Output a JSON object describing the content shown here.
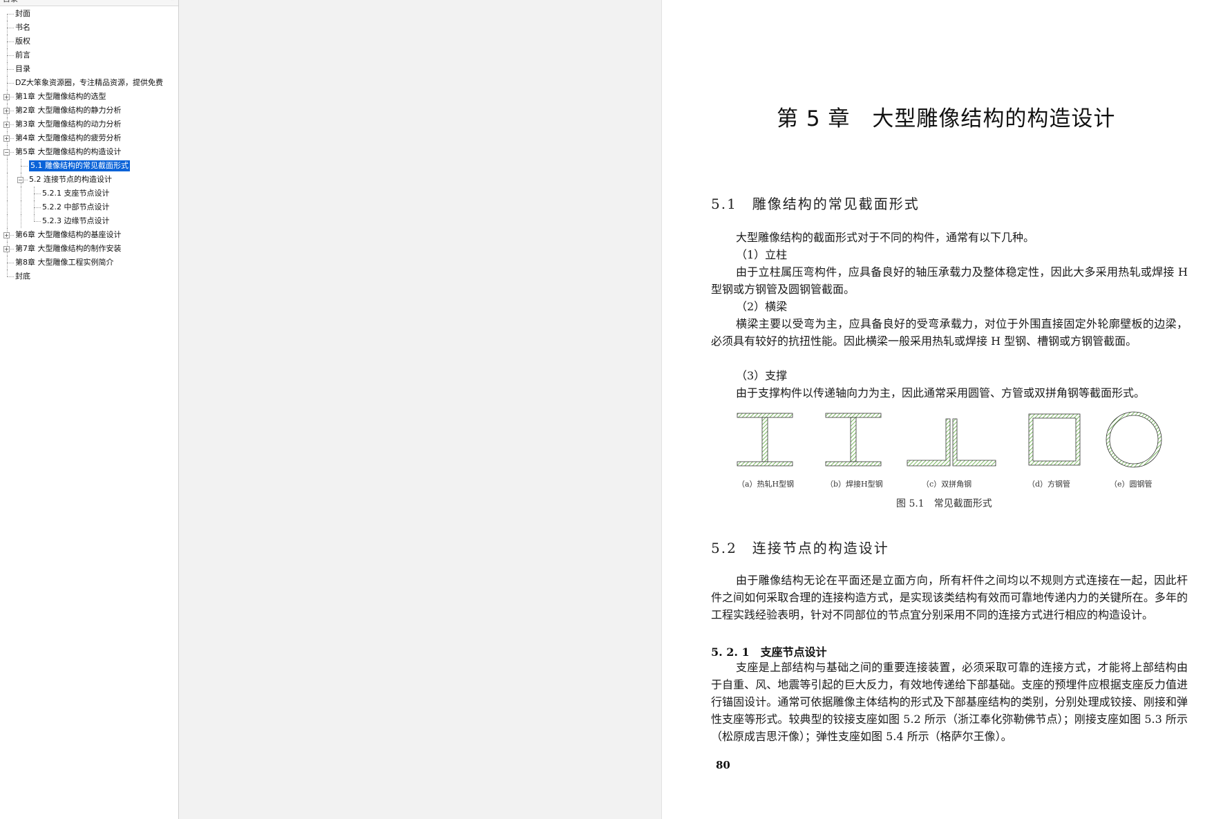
{
  "sidebar": {
    "header_title": "目录",
    "close_glyph": "«",
    "items": [
      {
        "label": "封面",
        "level": 0,
        "toggle": ""
      },
      {
        "label": "书名",
        "level": 0,
        "toggle": ""
      },
      {
        "label": "版权",
        "level": 0,
        "toggle": ""
      },
      {
        "label": "前言",
        "level": 0,
        "toggle": ""
      },
      {
        "label": "目录",
        "level": 0,
        "toggle": ""
      },
      {
        "label": "DZ大笨象资源圈，专注精品资源，提供免费",
        "level": 0,
        "toggle": ""
      },
      {
        "label": "第1章 大型雕像结构的选型",
        "level": 0,
        "toggle": "+"
      },
      {
        "label": "第2章 大型雕像结构的静力分析",
        "level": 0,
        "toggle": "+"
      },
      {
        "label": "第3章 大型雕像结构的动力分析",
        "level": 0,
        "toggle": "+"
      },
      {
        "label": "第4章 大型雕像结构的疲劳分析",
        "level": 0,
        "toggle": "+"
      },
      {
        "label": "第5章 大型雕像结构的构造设计",
        "level": 0,
        "toggle": "−"
      },
      {
        "label": "5.1 雕像结构的常见截面形式",
        "level": 1,
        "toggle": "",
        "selected": true
      },
      {
        "label": "5.2 连接节点的构造设计",
        "level": 1,
        "toggle": "−"
      },
      {
        "label": "5.2.1 支座节点设计",
        "level": 2,
        "toggle": ""
      },
      {
        "label": "5.2.2 中部节点设计",
        "level": 2,
        "toggle": ""
      },
      {
        "label": "5.2.3 边缘节点设计",
        "level": 2,
        "toggle": ""
      },
      {
        "label": "第6章 大型雕像结构的基座设计",
        "level": 0,
        "toggle": "+"
      },
      {
        "label": "第7章 大型雕像结构的制作安装",
        "level": 0,
        "toggle": "+"
      },
      {
        "label": "第8章 大型雕像工程实例简介",
        "level": 0,
        "toggle": ""
      },
      {
        "label": "封底",
        "level": 0,
        "toggle": ""
      }
    ]
  },
  "page": {
    "chapter_title": "第 5 章　大型雕像结构的构造设计",
    "section1_title": "5.1　雕像结构的常见截面形式",
    "p1": "大型雕像结构的截面形式对于不同的构件，通常有以下几种。",
    "item1": "（1）立柱",
    "p2": "由于立柱属压弯构件，应具备良好的轴压承载力及整体稳定性，因此大多采用热轧或焊接 H 型钢或方钢管及圆钢管截面。",
    "item2": "（2）横梁",
    "p3": "横梁主要以受弯为主，应具备良好的受弯承载力，对位于外围直接固定外轮廓壁板的边梁，必须具有较好的抗扭性能。因此横梁一般采用热轧或焊接 H 型钢、槽钢或方钢管截面。",
    "item3": "（3）支撑",
    "p4": "由于支撑构件以传递轴向力为主，因此通常采用圆管、方管或双拼角钢等截面形式。",
    "figure": {
      "captions": [
        "（a）热轧H型钢",
        "（b）焊接H型钢",
        "（c）双拼角钢",
        "（d）方钢管",
        "（e）圆钢管"
      ],
      "caption": "图 5.1　常见截面形式",
      "color": "#7ec850"
    },
    "section2_title": "5.2　连接节点的构造设计",
    "p5": "由于雕像结构无论在平面还是立面方向，所有杆件之间均以不规则方式连接在一起，因此杆件之间如何采取合理的连接构造方式，是实现该类结构有效而可靠地传递内力的关键所在。多年的工程实践经验表明，针对不同部位的节点宜分别采用不同的连接方式进行相应的构造设计。",
    "subsection_title": "5. 2. 1　支座节点设计",
    "p6": "支座是上部结构与基础之间的重要连接装置，必须采取可靠的连接方式，才能将上部结构由于自重、风、地震等引起的巨大反力，有效地传递给下部基础。支座的预埋件应根据支座反力值进行锚固设计。通常可依据雕像主体结构的形式及下部基座结构的类别，分别处理成铰接、刚接和弹性支座等形式。较典型的铰接支座如图 5.2 所示（浙江奉化弥勒佛节点）；刚接支座如图 5.3 所示（松原成吉思汗像）；弹性支座如图 5.4 所示（格萨尔王像）。",
    "page_number": "80"
  }
}
